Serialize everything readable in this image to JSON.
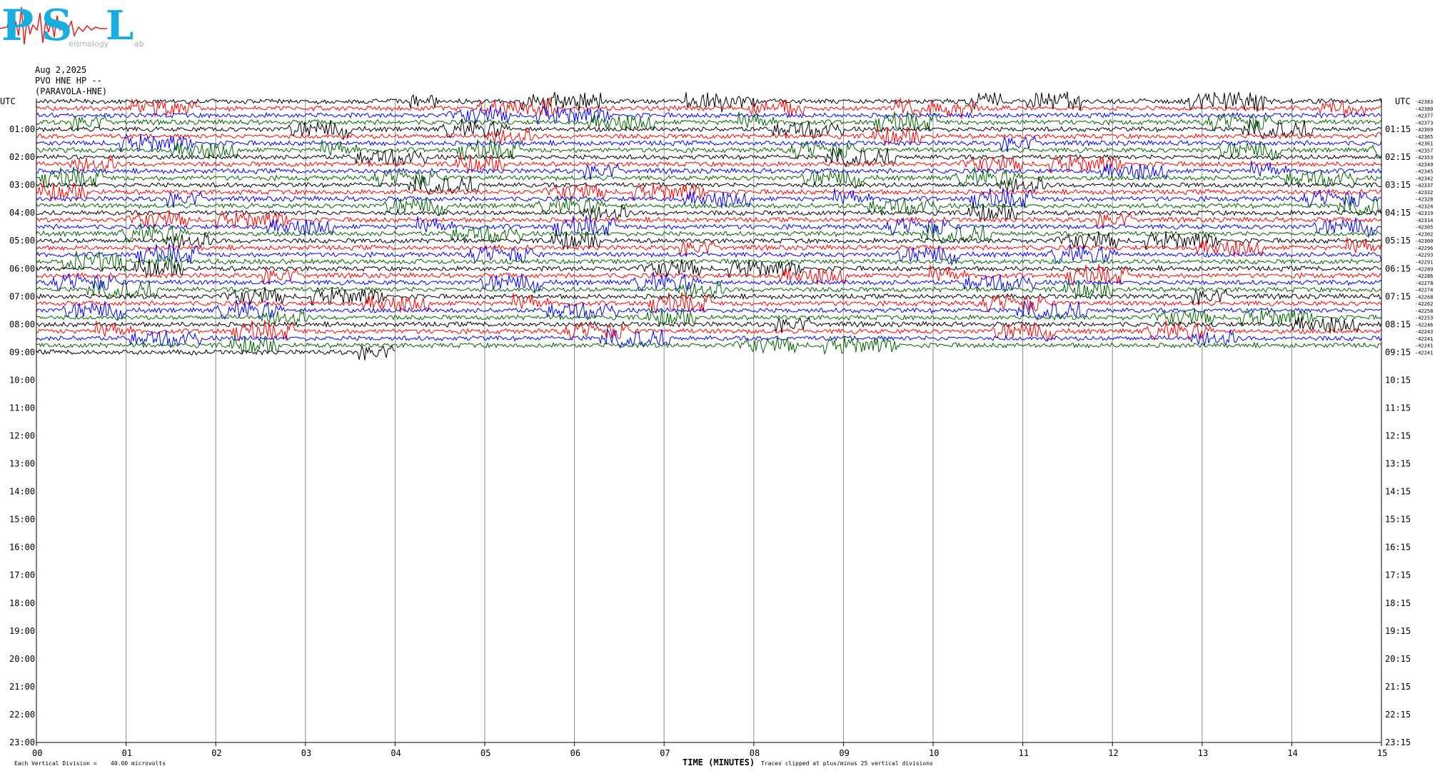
{
  "logo": {
    "letters": [
      "P",
      "S",
      "L"
    ],
    "subtext": "eismology",
    "subtext_end": "ab",
    "color": "#19aee0"
  },
  "header": {
    "date": "Aug 2,2025",
    "channel": "PVO HNE HP --",
    "station": "(PARAVOLA-HNE)"
  },
  "chart_data": {
    "type": "line",
    "title": "",
    "left_label_header": "UTC",
    "right_label_header": "UTC",
    "left_hours": [
      "01:00",
      "02:00",
      "03:00",
      "04:00",
      "05:00",
      "06:00",
      "07:00",
      "08:00",
      "09:00",
      "10:00",
      "11:00",
      "12:00",
      "13:00",
      "14:00",
      "15:00",
      "16:00",
      "17:00",
      "18:00",
      "19:00",
      "20:00",
      "21:00",
      "22:00",
      "23:00"
    ],
    "right_hours": [
      "01:15",
      "02:15",
      "03:15",
      "04:15",
      "05:15",
      "06:15",
      "07:15",
      "08:15",
      "09:15",
      "10:15",
      "11:15",
      "12:15",
      "13:15",
      "14:15",
      "15:15",
      "16:15",
      "17:15",
      "18:15",
      "19:15",
      "20:15",
      "21:15",
      "22:15",
      "23:15"
    ],
    "x_ticks": [
      "00",
      "01",
      "02",
      "03",
      "04",
      "05",
      "06",
      "07",
      "08",
      "09",
      "10",
      "11",
      "12",
      "13",
      "14",
      "15"
    ],
    "xlabel": "TIME (MINUTES)",
    "xlim": [
      0,
      15
    ],
    "trace_colors": [
      "#000000",
      "#ff0000",
      "#0000ff",
      "#006400"
    ],
    "trace_interval_minutes": 15,
    "total_hours": 24,
    "complete_traces": 36,
    "last_trace_minutes": 4,
    "trace_offsets": [
      "-42383",
      "-42380",
      "-42377",
      "-42373",
      "-42369",
      "-42365",
      "-42361",
      "-42357",
      "-42353",
      "-42349",
      "-42345",
      "-42342",
      "-42337",
      "-42332",
      "-42328",
      "-42324",
      "-42319",
      "-42314",
      "-42305",
      "-42302",
      "-42300",
      "-42296",
      "-42293",
      "-42291",
      "-42289",
      "-42286",
      "-42278",
      "-42274",
      "-42268",
      "-42262",
      "-42258",
      "-42253",
      "-42246",
      "-42243",
      "-42241",
      "-42241",
      "-42241"
    ],
    "footer_left_prefix": "Each Vertical Division =",
    "footer_left_value": "40.00 microvolts",
    "footer_right": "Traces clipped at plus/minus 25 vertical divisions"
  }
}
